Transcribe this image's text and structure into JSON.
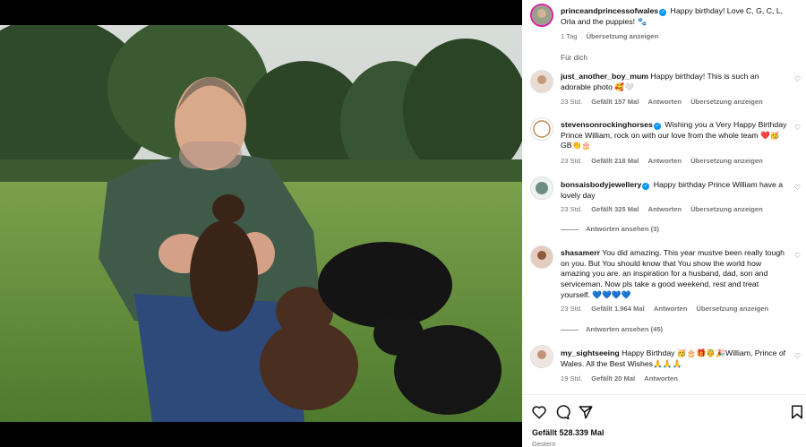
{
  "post": {
    "author": "princeandprincessofwales",
    "caption": "Happy birthday! Love C, G, C, L, Orla and the puppies! 🐾",
    "caption_time": "1 Tag",
    "caption_translate": "Übersetzung anzeigen",
    "for_you_label": "Für dich",
    "likes": "Gefällt 528.339 Mal",
    "posted": "Gestern"
  },
  "comments": [
    {
      "user": "just_another_boy_mum",
      "verified": false,
      "text": "Happy birthday! This is such an adorable photo 🥰🤍",
      "time": "23 Std.",
      "likes": "Gefällt 157 Mal",
      "reply": "Antworten",
      "translate": "Übersetzung anzeigen"
    },
    {
      "user": "stevensonrockinghorses",
      "verified": true,
      "text": "Wishing you a Very Happy Birthday Prince William, rock on with our love from the whole team ❤️🥳GB👏🎂",
      "time": "23 Std.",
      "likes": "Gefällt 218 Mal",
      "reply": "Antworten",
      "translate": "Übersetzung anzeigen"
    },
    {
      "user": "bonsaisbodyjewellery",
      "verified": true,
      "text": "Happy birthday Prince William have a lovely day",
      "time": "23 Std.",
      "likes": "Gefällt 325 Mal",
      "reply": "Antworten",
      "translate": "Übersetzung anzeigen",
      "view_replies": "Antworten ansehen (3)"
    },
    {
      "user": "shasamerr",
      "verified": false,
      "text": "You did amazing. This year mustve been really tough on you. But You should know that You show the world how amazing you are. an inspiration for a husband, dad, son and serviceman. Now pls take a good weekend, rest and treat yourself. 💙💙💙💙",
      "time": "23 Std.",
      "likes": "Gefällt 1.964 Mal",
      "reply": "Antworten",
      "translate": "Übersetzung anzeigen",
      "view_replies": "Antworten ansehen (45)"
    },
    {
      "user": "my_sightseeing",
      "verified": false,
      "text": "Happy Birthday 🥳🎂🎁🤴🎉William, Prince of Wales. All the Best Wishes🙏🙏🙏",
      "time": "19 Std.",
      "likes": "Gefällt 20 Mal",
      "reply": "Antworten"
    }
  ],
  "icons": {
    "like": "heart-icon",
    "comment": "comment-icon",
    "share": "share-icon",
    "save": "bookmark-icon"
  },
  "colors": {
    "verified": "#0095f6",
    "meta_gray": "#737373",
    "background": "#ffffff"
  }
}
